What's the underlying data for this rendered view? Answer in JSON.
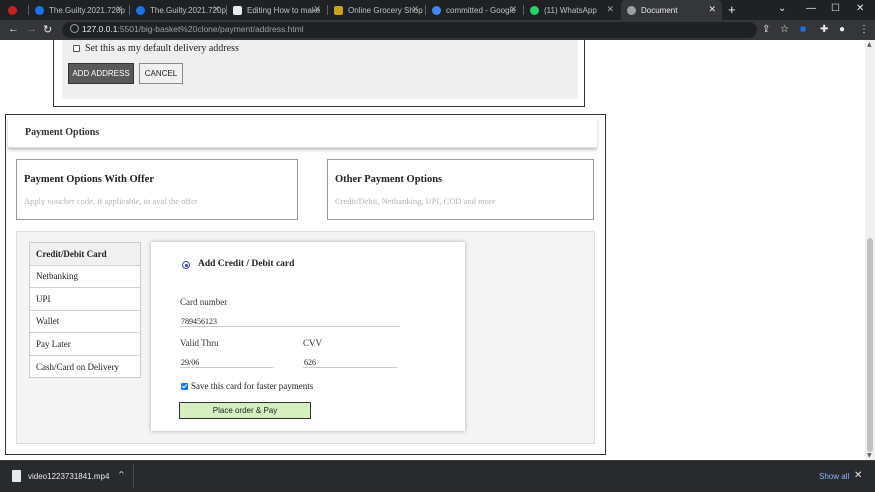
{
  "browser": {
    "tabs": [
      {
        "title": "",
        "icon": "chrome-flag-icon",
        "color": "#c5221f"
      },
      {
        "title": "The.Guilty.2021.720p",
        "icon": "media-icon",
        "color": "#1a73e8"
      },
      {
        "title": "The.Guilty.2021.720p",
        "icon": "media-icon",
        "color": "#1a73e8"
      },
      {
        "title": "Editing How to make",
        "icon": "medium-icon",
        "color": "#e8eaed"
      },
      {
        "title": "Online Grocery Shop",
        "icon": "bigbasket-icon",
        "color": "#c8a31b"
      },
      {
        "title": "committed - Google",
        "icon": "google-icon",
        "color": "#4285f4"
      },
      {
        "title": "(11) WhatsApp",
        "icon": "whatsapp-icon",
        "color": "#25d366"
      },
      {
        "title": "Document",
        "icon": "globe-icon",
        "color": "#9aa0a6"
      }
    ],
    "url_host": "127.0.0.1",
    "url_path": ":5501/big-basket%20clone/payment/address.html"
  },
  "address": {
    "default_label": "Set this as my default delivery address",
    "add_button": "ADD ADDRESS",
    "cancel_button": "CANCEL"
  },
  "payment": {
    "header": "Payment Options",
    "offer_title": "Payment Options With Offer",
    "offer_sub": "Apply voucher code, if applicable, to aval the offer",
    "other_title": "Other Payment Options",
    "other_sub": "Credit/Debit, Netbanking, UPI, COD and more",
    "methods": [
      "Credit/Debit Card",
      "Netbanking",
      "UPI",
      "Wallet",
      "Pay Later",
      "Cash/Card on Delivery"
    ],
    "card": {
      "title": "Add Credit / Debit card",
      "number_label": "Card number",
      "number_value": "789456123",
      "valid_label": "Valid Thru",
      "valid_value": "29/06",
      "cvv_label": "CVV",
      "cvv_value": "626",
      "save_label": "Save this card for faster payments",
      "place_button": "Place order & Pay"
    }
  },
  "downloads": {
    "file_name": "video1223731841.mp4",
    "show_all": "Show all"
  }
}
